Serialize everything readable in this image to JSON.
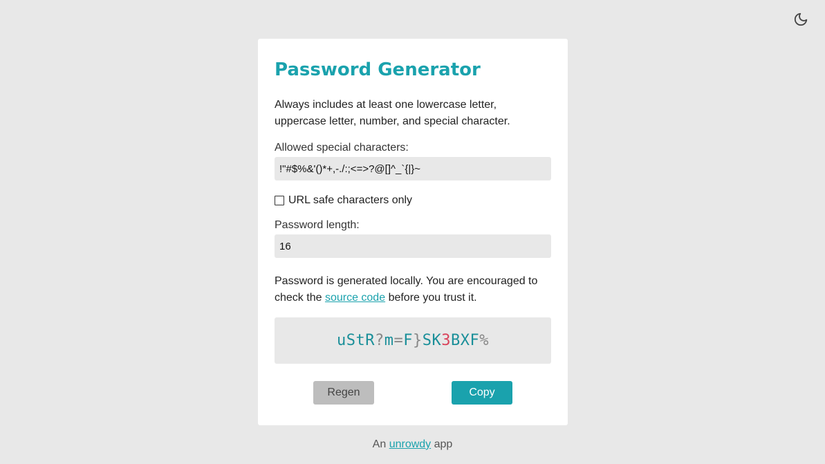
{
  "theme_toggle": {
    "icon": "moon-icon"
  },
  "card": {
    "title": "Password Generator",
    "description": "Always includes at least one lowercase letter, uppercase letter, number, and special character.",
    "special_chars": {
      "label": "Allowed special characters:",
      "value": "!\"#$%&'()*+,-./:;<=>?@[]^_`{|}~"
    },
    "url_safe": {
      "label": "URL safe characters only",
      "checked": false
    },
    "length": {
      "label": "Password length:",
      "value": "16"
    },
    "notice": {
      "before": "Password is generated locally. You are encouraged to check the",
      "link_text": "source code",
      "after": "before you trust it."
    },
    "password": {
      "value": "uStR?m=F}SK3BXF%",
      "segments": [
        {
          "text": "uStR",
          "kind": "letter"
        },
        {
          "text": "?",
          "kind": "special"
        },
        {
          "text": "m",
          "kind": "letter"
        },
        {
          "text": "=",
          "kind": "special"
        },
        {
          "text": "F",
          "kind": "letter"
        },
        {
          "text": "}",
          "kind": "special"
        },
        {
          "text": "SK",
          "kind": "letter"
        },
        {
          "text": "3",
          "kind": "number"
        },
        {
          "text": "BXF",
          "kind": "letter"
        },
        {
          "text": "%",
          "kind": "special"
        }
      ]
    },
    "buttons": {
      "regen_label": "Regen",
      "copy_label": "Copy"
    }
  },
  "footer": {
    "before": "An",
    "link_text": "unrowdy",
    "after": "app"
  },
  "colors": {
    "accent": "#1aa2ad",
    "background": "#e8e8e8",
    "number": "#d9435b",
    "special": "#888888"
  }
}
